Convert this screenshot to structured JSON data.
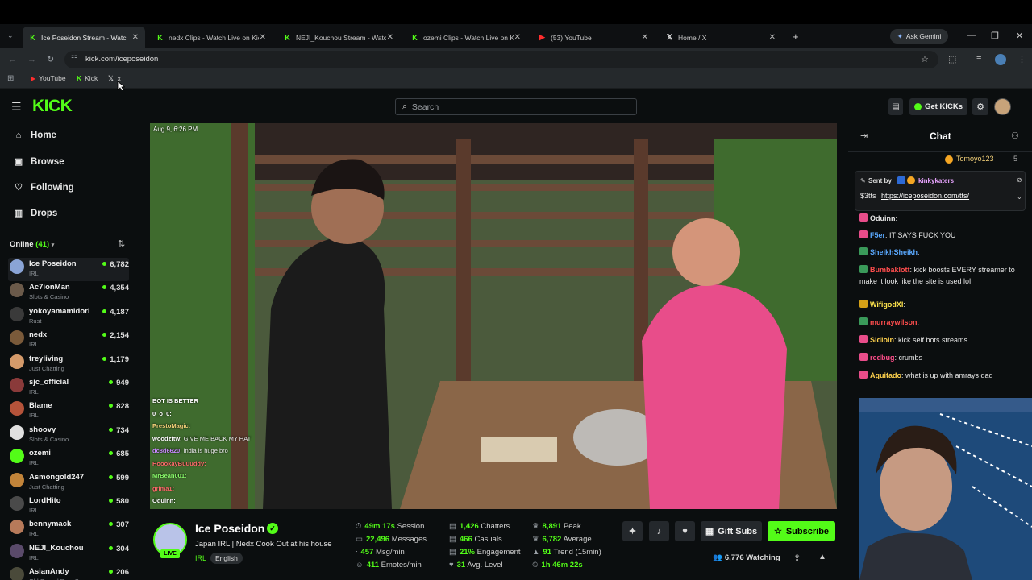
{
  "browser": {
    "tabs": [
      {
        "label": "Ice Poseidon Stream - Watc",
        "icon": "kick-icon",
        "active": true
      },
      {
        "label": "nedx Clips - Watch Live on Kick",
        "icon": "kick-icon"
      },
      {
        "label": "NEJI_Kouchou Stream - Watch",
        "icon": "kick-icon"
      },
      {
        "label": "ozemi Clips - Watch Live on Ki",
        "icon": "kick-icon"
      },
      {
        "label": "(53) YouTube",
        "icon": "youtube-icon"
      },
      {
        "label": "Home / X",
        "icon": "x-icon"
      }
    ],
    "ask_gemini": "Ask Gemini",
    "url": "kick.com/iceposeidon",
    "bookmarks": [
      "YouTube",
      "Kick",
      "X"
    ]
  },
  "header": {
    "logo": "KICK",
    "search_placeholder": "Search",
    "get_kicks": "Get KICKs"
  },
  "sidebar": {
    "nav": [
      {
        "label": "Home",
        "icon": "home-icon"
      },
      {
        "label": "Browse",
        "icon": "browse-icon"
      },
      {
        "label": "Following",
        "icon": "heart-icon"
      },
      {
        "label": "Drops",
        "icon": "drops-icon"
      }
    ],
    "online_label": "Online",
    "online_count": "(41)",
    "channels": [
      {
        "name": "Ice Poseidon",
        "category": "IRL",
        "viewers": "6,782"
      },
      {
        "name": "Ac7ionMan",
        "category": "Slots & Casino",
        "viewers": "4,354"
      },
      {
        "name": "yokoyamamidori",
        "category": "Rust",
        "viewers": "4,187"
      },
      {
        "name": "nedx",
        "category": "IRL",
        "viewers": "2,154"
      },
      {
        "name": "treyliving",
        "category": "Just Chatting",
        "viewers": "1,179"
      },
      {
        "name": "sjc_official",
        "category": "IRL",
        "viewers": "949"
      },
      {
        "name": "Blame",
        "category": "IRL",
        "viewers": "828"
      },
      {
        "name": "shoovy",
        "category": "Slots & Casino",
        "viewers": "734"
      },
      {
        "name": "ozemi",
        "category": "IRL",
        "viewers": "685"
      },
      {
        "name": "Asmongold247",
        "category": "Just Chatting",
        "viewers": "599"
      },
      {
        "name": "LordHito",
        "category": "IRL",
        "viewers": "580"
      },
      {
        "name": "bennymack",
        "category": "IRL",
        "viewers": "307"
      },
      {
        "name": "NEJI_Kouchou",
        "category": "IRL",
        "viewers": "304"
      },
      {
        "name": "AsianAndy",
        "category": "Old School RuneScape",
        "viewers": "206"
      }
    ]
  },
  "video": {
    "timestamp": "Aug 9, 6:26 PM",
    "overlay_chat": [
      {
        "user": "BOT IS BETTER",
        "text": ""
      },
      {
        "user": "0_o_0:",
        "text": ""
      },
      {
        "user": "PrestoMagic:",
        "text": ""
      },
      {
        "user": "woodzftw:",
        "text": "GIVE ME BACK MY HAT"
      },
      {
        "user": "dc8d6620:",
        "text": "india is huge bro"
      },
      {
        "user": "HoookayBuuuddy:",
        "text": ""
      },
      {
        "user": "MrBean001:",
        "text": ""
      },
      {
        "user": "grima1:",
        "text": ""
      },
      {
        "user": "Oduinn:",
        "text": ""
      }
    ]
  },
  "stream": {
    "name": "Ice Poseidon",
    "title": "Japan IRL | Nedx Cook Out at his house",
    "category": "IRL",
    "language": "English",
    "live_badge": "LIVE",
    "stats": [
      {
        "value": "49m 17s",
        "label": "Session"
      },
      {
        "value": "22,496",
        "label": "Messages"
      },
      {
        "value": "457",
        "label": "Msg/min"
      },
      {
        "value": "411",
        "label": "Emotes/min"
      },
      {
        "value": "1,426",
        "label": "Chatters"
      },
      {
        "value": "466",
        "label": "Casuals"
      },
      {
        "value": "21%",
        "label": "Engagement"
      },
      {
        "value": "31",
        "label": "Avg. Level"
      },
      {
        "value": "8,891",
        "label": "Peak"
      },
      {
        "value": "6,782",
        "label": "Average"
      },
      {
        "value": "91",
        "label": "Trend (15min)"
      },
      {
        "value": "1h 46m 22s",
        "label": ""
      }
    ],
    "gift_subs": "Gift Subs",
    "subscribe": "Subscribe",
    "watching": "6,776 Watching"
  },
  "chat": {
    "title": "Chat",
    "pinned_user": "Tomoyo123",
    "pinned_count": "5",
    "sent_by_label": "Sent by",
    "sent_by_user": "kinkykaters",
    "tts_amount": "$3tts",
    "tts_link": "https://iceposeidon.com/tts/",
    "messages": [
      {
        "user": "Oduinn",
        "text": "",
        "color": "#e8e8e8"
      },
      {
        "user": "F5er",
        "text": "IT SAYS FUCK YOU",
        "color": "#5aa9ff"
      },
      {
        "user": "SheikhSheikh",
        "text": "",
        "color": "#5aa9ff"
      },
      {
        "user": "Bumbaklott",
        "text": "kick boosts EVERY streamer to make it look like the site is used lol",
        "color": "#ff4d4d"
      },
      {
        "user": "WifigodXI",
        "text": "",
        "color": "#ffe44d"
      },
      {
        "user": "murraywilson",
        "text": "",
        "color": "#ff4d4d"
      },
      {
        "user": "Sidloin",
        "text": "kick self bots streams",
        "color": "#ffd24d"
      },
      {
        "user": "redbug",
        "text": "crumbs",
        "color": "#ff4d8a"
      },
      {
        "user": "Aguitado",
        "text": "what is up with amrays dad",
        "color": "#ffd24d"
      }
    ]
  }
}
